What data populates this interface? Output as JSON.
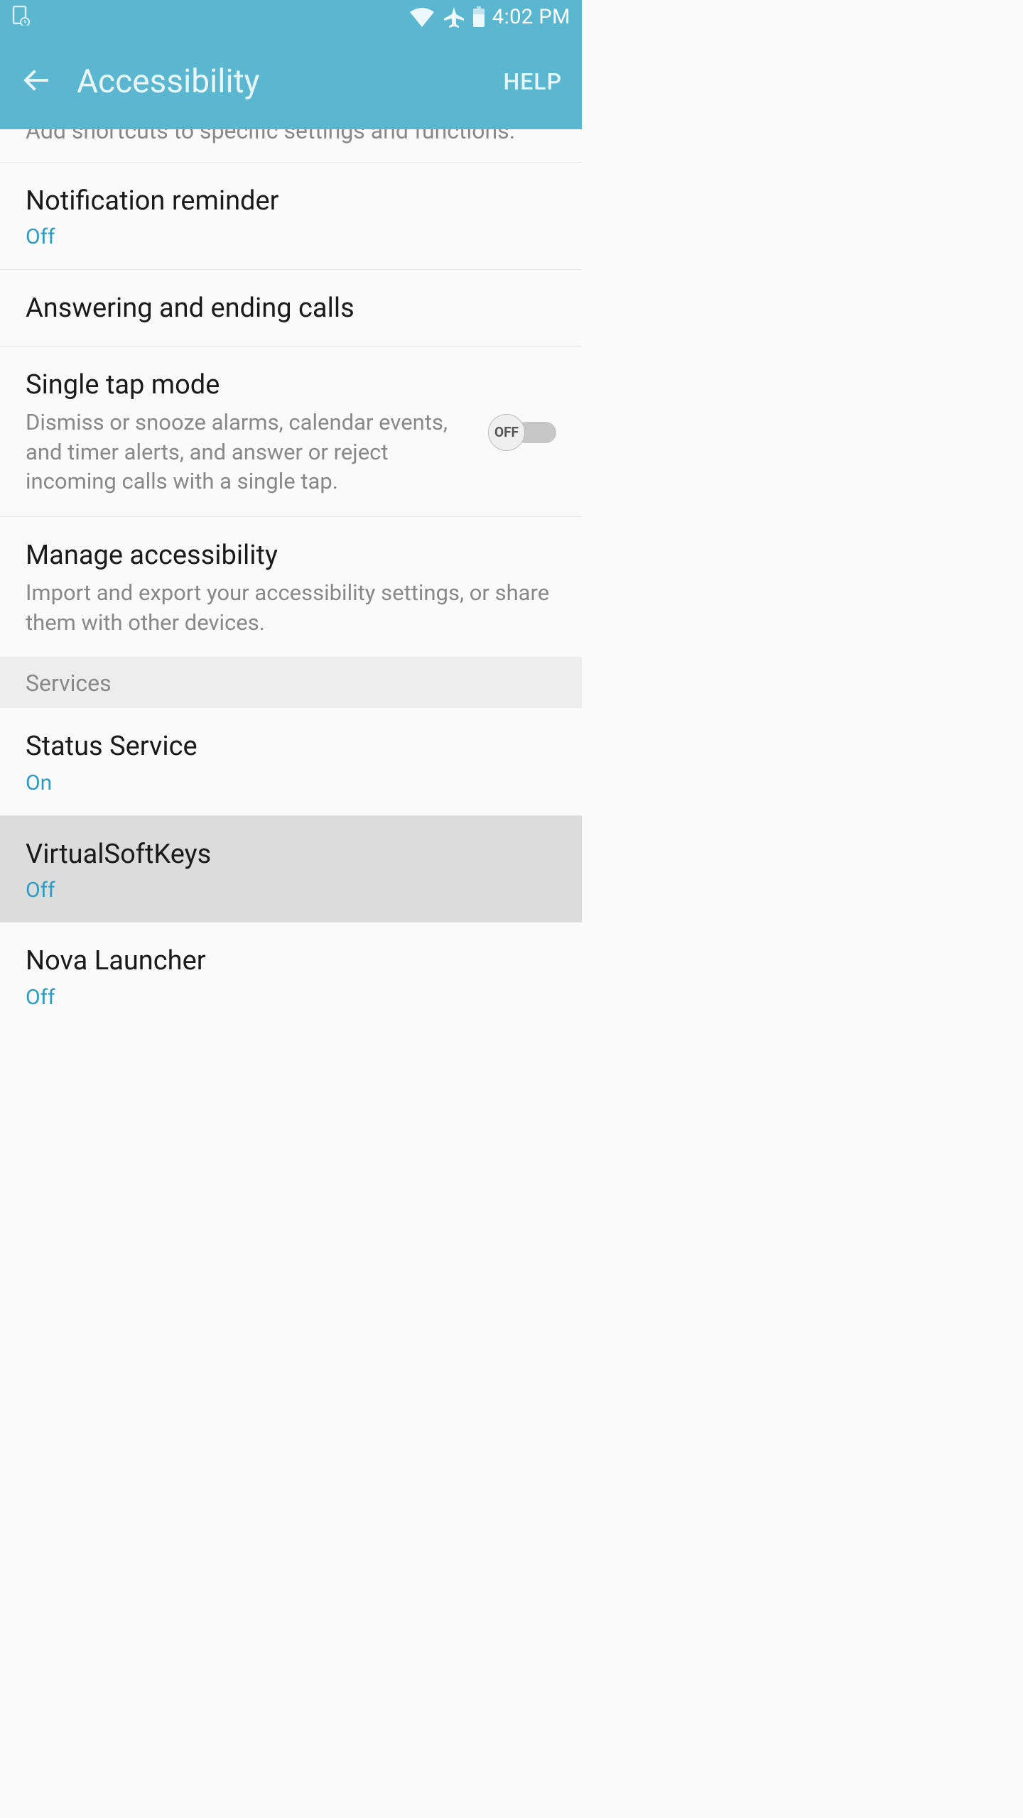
{
  "statusBar": {
    "time": "4:02 PM"
  },
  "appBar": {
    "title": "Accessibility",
    "help": "HELP"
  },
  "partialItem": {
    "description": "Add shortcuts to specific settings and functions."
  },
  "items": [
    {
      "title": "Notification reminder",
      "status": "Off"
    },
    {
      "title": "Answering and ending calls"
    },
    {
      "title": "Single tap mode",
      "description": "Dismiss or snooze alarms, calendar events, and timer alerts, and answer or reject incoming calls with a single tap.",
      "toggleLabel": "OFF"
    },
    {
      "title": "Manage accessibility",
      "description": "Import and export your accessibility settings, or share them with other devices."
    }
  ],
  "sectionHeader": "Services",
  "services": [
    {
      "title": "Status Service",
      "status": "On"
    },
    {
      "title": "VirtualSoftKeys",
      "status": "Off"
    },
    {
      "title": "Nova Launcher",
      "status": "Off"
    }
  ]
}
